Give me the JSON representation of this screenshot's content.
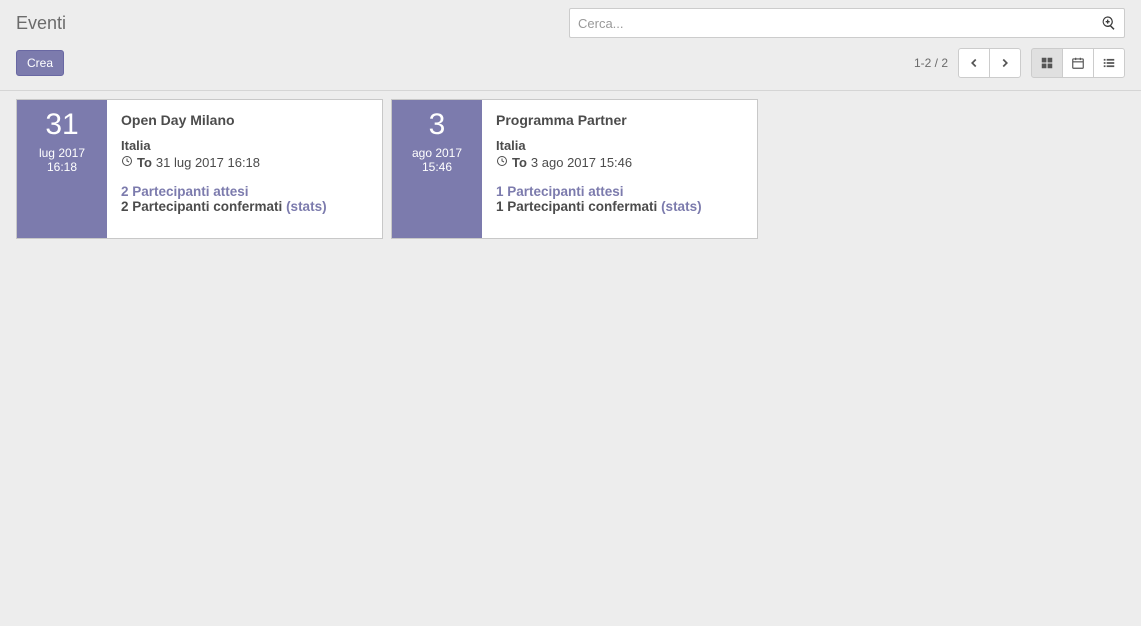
{
  "header": {
    "title": "Eventi",
    "search_placeholder": "Cerca...",
    "create_label": "Crea",
    "pager": "1-2 / 2"
  },
  "events": [
    {
      "date_day": "31",
      "date_month": "lug 2017",
      "date_time": "16:18",
      "title": "Open Day Milano",
      "country": "Italia",
      "to_label": "To",
      "to_value": "31 lug 2017 16:18",
      "expected": "2 Partecipanti attesi",
      "confirmed_prefix": "2 Partecipanti confermati ",
      "stats": "(stats)"
    },
    {
      "date_day": "3",
      "date_month": "ago 2017",
      "date_time": "15:46",
      "title": "Programma Partner",
      "country": "Italia",
      "to_label": "To",
      "to_value": "3 ago 2017 15:46",
      "expected": "1 Partecipanti attesi",
      "confirmed_prefix": "1 Partecipanti confermati ",
      "stats": "(stats)"
    }
  ]
}
